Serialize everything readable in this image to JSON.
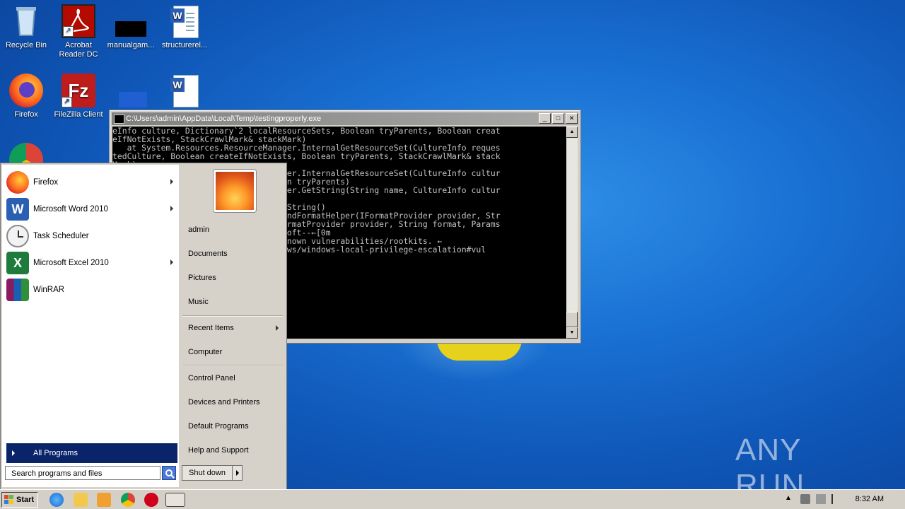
{
  "desktop": {
    "icons": [
      {
        "label": "Recycle Bin"
      },
      {
        "label": "Acrobat Reader DC"
      },
      {
        "label": "manualgam..."
      },
      {
        "label": "structurerel..."
      },
      {
        "label": "Firefox"
      },
      {
        "label": "FileZilla Client"
      }
    ],
    "watermark": "ANY RUN"
  },
  "console": {
    "title": "C:\\Users\\admin\\AppData\\Local\\Temp\\testingproperly.exe",
    "lines": [
      "eInfo culture, Dictionary`2 localResourceSets, Boolean tryParents, Boolean creat",
      "eIfNotExists, StackCrawlMark& stackMark)",
      "   at System.Resources.ResourceManager.InternalGetResourceSet(CultureInfo reques",
      "tedCulture, Boolean createIfNotExists, Boolean tryParents, StackCrawlMark& stack",
      "Mark)",
      "   at System.Resources.ResourceManager.InternalGetResourceSet(CultureInfo cultur",
      "e, Boolean createIfNotExists, Boolean tryParents)",
      "   at System.Resources.ResourceManager.GetString(String name, CultureInfo cultur",
      "e)",
      "",
      "   at ...TaskScheduler.ExecAction.ToString()",
      "",
      "   at System.Text.StringBuilder.AppendFormatHelper(IFormatProvider provider, Str",
      "",
      "   at System.String.FormatHelper(IFormatProvider provider, String format, Params",
      "",
      "",
      "",
      "",
      "   ... Checking drivers --Non Microsoft--←[0m",
      "   ... Check 3rd party drivers for known vulnerabilities/rootkits. ←",
      "   https://book.hacktricks.xyz/windows/windows-local-privilege-escalation#vul"
    ]
  },
  "start_menu": {
    "programs": [
      {
        "label": "Firefox",
        "has_submenu": true
      },
      {
        "label": "Microsoft Word 2010",
        "has_submenu": true
      },
      {
        "label": "Task Scheduler",
        "has_submenu": false
      },
      {
        "label": "Microsoft Excel 2010",
        "has_submenu": true
      },
      {
        "label": "WinRAR",
        "has_submenu": false
      }
    ],
    "all_programs": "All Programs",
    "search_placeholder": "Search programs and files",
    "right": {
      "user": "admin",
      "documents": "Documents",
      "pictures": "Pictures",
      "music": "Music",
      "recent_items": "Recent Items",
      "computer": "Computer",
      "control_panel": "Control Panel",
      "devices_printers": "Devices and Printers",
      "default_programs": "Default Programs",
      "help_support": "Help and Support"
    },
    "shutdown": "Shut down"
  },
  "taskbar": {
    "start": "Start",
    "clock": "8:32 AM"
  }
}
